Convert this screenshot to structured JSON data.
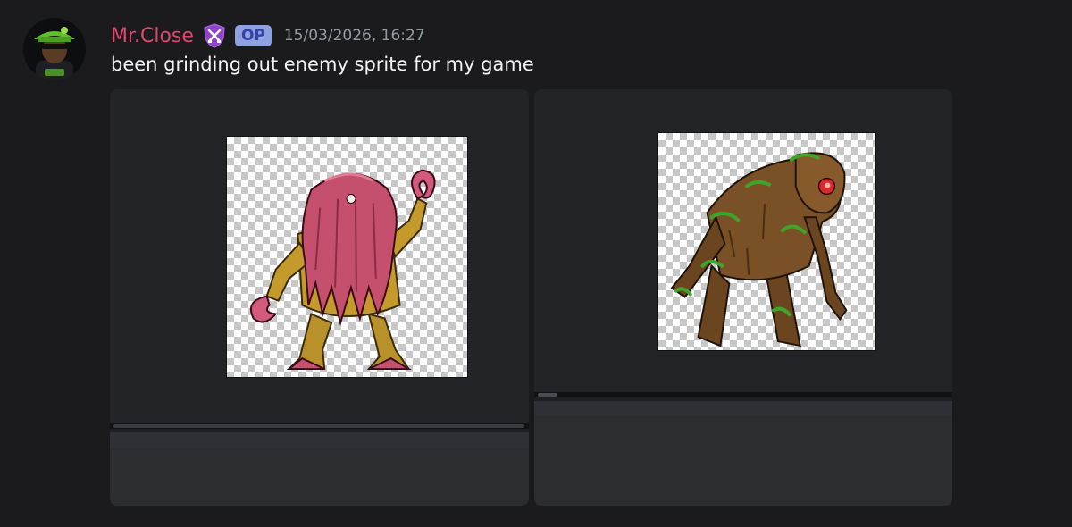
{
  "message": {
    "username": "Mr.Close",
    "op_badge": "OP",
    "timestamp": "15/03/2026, 16:27",
    "content": "been grinding out enemy sprite for my game",
    "colors": {
      "username": "#e0476d",
      "guild_badge": "#9b4fd6",
      "op_badge_bg": "#8ea1e1"
    }
  },
  "attachments": [
    {
      "name": "sprite-tentacle-monster",
      "subject": "pink-tentacled-yellow-creature-icon"
    },
    {
      "name": "sprite-swamp-creature",
      "subject": "mossy-tree-golem-icon"
    }
  ]
}
